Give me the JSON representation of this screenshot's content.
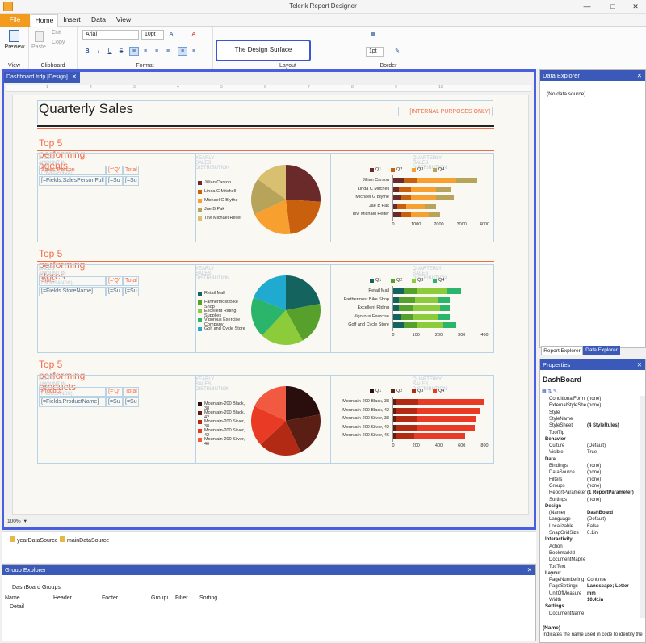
{
  "app": {
    "title": "Telerik Report Designer"
  },
  "tabs": [
    "File",
    "Home",
    "Insert",
    "Data",
    "View"
  ],
  "ribbon": {
    "preview_label": "Preview",
    "view_label": "View",
    "paste_label": "Paste",
    "cut_label": "Cut",
    "copy_label": "Copy",
    "clipboard_label": "Clipboard",
    "font_name": "Arial",
    "font_size": "10pt",
    "format_label": "Format",
    "callout": "The Design Surface",
    "layout_label": "Layout",
    "border_width": "1pt",
    "border_label": "Border"
  },
  "document": {
    "tab": "Dashboard.trdp [Design]",
    "ruler": [
      "1",
      "2",
      "3",
      "4",
      "5",
      "6",
      "7",
      "8",
      "9",
      "10"
    ],
    "title": "Quarterly Sales",
    "internal": "[INTERNAL PURPOSES ONLY]",
    "zoom": "100%"
  },
  "sections": [
    {
      "title": "Top 5 performing agents",
      "col1": "SALES AMOUNT IN USD (THOUSANDS)",
      "col2": "YEARLY SALES DISTRIBUTION",
      "col3": "QUARTERLY SALES DISTRIBUTION",
      "th": [
        "Sales Person",
        "[='Q'",
        "Total"
      ],
      "td": [
        "[=Fields.SalesPersonFull",
        "[=Su",
        "[=Su"
      ],
      "legend": [
        "Jillian  Carson",
        "Linda C Mitchell",
        "Michael G Blythe",
        "Jae B Pak",
        "Tsvi Michael Reiter"
      ],
      "colors": [
        "#6b2a2a",
        "#c8600e",
        "#f7a030",
        "#b7a45a",
        "#d8c070"
      ],
      "xticks": [
        "0",
        "1000",
        "2000",
        "3000",
        "4000"
      ],
      "quarters": [
        "Q1",
        "Q2",
        "Q3",
        "Q4"
      ]
    },
    {
      "title": "Top 5 performing stores",
      "col1": "SALES AMOUNT IN USD (THOUSANDS)",
      "col2": "YEARLY SALES DISTRIBUTION",
      "col3": "QUARTERLY SALES DISTRIBUTION",
      "th": [
        "Store",
        "[='Q'",
        "Total"
      ],
      "td": [
        "[=Fields.StoreName]",
        "[=Su",
        "[=Su"
      ],
      "legend": [
        "Retail Mall",
        "Farthermost Bike Shop",
        "Excellent Riding Supplies",
        "Vigorous Exercise Company",
        "Golf and Cycle Store"
      ],
      "colors": [
        "#14635f",
        "#58a02c",
        "#8ccc3a",
        "#2ab56a",
        "#20aad0"
      ],
      "xticks": [
        "0",
        "100",
        "200",
        "300",
        "400"
      ],
      "quarters": [
        "Q1",
        "Q2",
        "Q3",
        "Q4"
      ]
    },
    {
      "title": "Top 5 performing products",
      "col1": "SALES AMOUNT IN USD (THOUSANDS)",
      "col2": "YEARLY SALES DISTRIBUTION",
      "col3": "QUARTERLY SALES DISTRIBUTION",
      "th": [
        "Product",
        "[='Q'",
        "Total"
      ],
      "td": [
        "[=Fields.ProductName]",
        "[=Su",
        "[=Su"
      ],
      "legend": [
        "Mountain-200 Black, 38",
        "Mountain-200 Black, 42",
        "Mountain-200 Silver, 38",
        "Mountain-200 Silver, 42",
        "Mountain-200 Silver, 46"
      ],
      "legend_short": [
        "Mountain-200 Black, 38",
        "Mountain-200 Black, 42",
        "Mountain-200 Silver, 38",
        "Mountain-200 Silver, 42",
        "Mountain-200 Silver, 46"
      ],
      "colors": [
        "#2a0d0d",
        "#5a1e14",
        "#b22a14",
        "#e83a24",
        "#f15a40"
      ],
      "xticks": [
        "0",
        "200",
        "400",
        "600",
        "800"
      ],
      "quarters": [
        "Q1",
        "Q2",
        "Q3",
        "Q4"
      ]
    }
  ],
  "datasources": [
    "yearDataSource",
    "mainDataSource"
  ],
  "group_explorer": {
    "title": "Group Explorer",
    "groups_label": "DashBoard Groups",
    "cols": [
      "Name",
      "Header",
      "Footer",
      "Groupi...",
      "Filter",
      "Sorting"
    ],
    "row": "Detail"
  },
  "data_explorer": {
    "title": "Data Explorer",
    "item": "(No data source)"
  },
  "explorer_tabs": [
    "Report Explorer",
    "Data Explorer"
  ],
  "properties": {
    "title": "Properties",
    "object": "DashBoard",
    "rows": [
      [
        "ConditionalFormi",
        "(none)",
        ""
      ],
      [
        "ExternalStyleShe",
        "(none)",
        ""
      ],
      [
        "Style",
        "",
        ""
      ],
      [
        "StyleName",
        "",
        ""
      ],
      [
        "StyleSheet",
        "(4 StyleRules)",
        "b"
      ],
      [
        "ToolTip",
        "",
        ""
      ],
      [
        "Behavior",
        "",
        "c"
      ],
      [
        "Culture",
        "(Default)",
        ""
      ],
      [
        "Visible",
        "True",
        ""
      ],
      [
        "Data",
        "",
        "c"
      ],
      [
        "Bindings",
        "(none)",
        ""
      ],
      [
        "DataSource",
        "(none)",
        ""
      ],
      [
        "Filters",
        "(none)",
        ""
      ],
      [
        "Groups",
        "(none)",
        ""
      ],
      [
        "ReportParameter",
        "(1 ReportParameter)",
        "b"
      ],
      [
        "Sortings",
        "(none)",
        ""
      ],
      [
        "Design",
        "",
        "c"
      ],
      [
        "(Name)",
        "DashBoard",
        "b"
      ],
      [
        "Language",
        "(Default)",
        ""
      ],
      [
        "Localizable",
        "False",
        ""
      ],
      [
        "SnapGridSize",
        "0.1in",
        ""
      ],
      [
        "Interactivity",
        "",
        "c"
      ],
      [
        "Action",
        "",
        ""
      ],
      [
        "BookmarkId",
        "",
        ""
      ],
      [
        "DocumentMapTe",
        "",
        ""
      ],
      [
        "TocText",
        "",
        ""
      ],
      [
        "Layout",
        "",
        "c"
      ],
      [
        "PageNumbering",
        "Continue",
        ""
      ],
      [
        "PageSettings",
        "Landscape; Letter",
        "b"
      ],
      [
        "UnitOfMeasure",
        "mm",
        "b"
      ],
      [
        "Width",
        "10.41in",
        "b"
      ],
      [
        "Settings",
        "",
        "c"
      ],
      [
        "DocumentName",
        "",
        ""
      ]
    ],
    "desc_title": "(Name)",
    "desc": "Indicates the name used in code to identify the ..."
  },
  "chart_data": [
    {
      "type": "bar",
      "stacked": true,
      "orientation": "horizontal",
      "categories": [
        "Jillian  Carson",
        "Linda C Mitchell",
        "Michael G Blythe",
        "Jae B Pak",
        "Tsvi Michael Reiter"
      ],
      "series": [
        {
          "name": "Q1",
          "values": [
            500,
            300,
            400,
            200,
            400
          ]
        },
        {
          "name": "Q2",
          "values": [
            600,
            500,
            400,
            400,
            400
          ]
        },
        {
          "name": "Q3",
          "values": [
            1700,
            1100,
            1100,
            800,
            800
          ]
        },
        {
          "name": "Q4",
          "values": [
            900,
            700,
            800,
            500,
            500
          ]
        }
      ],
      "xlim": [
        0,
        4000
      ]
    },
    {
      "type": "bar",
      "stacked": true,
      "orientation": "horizontal",
      "categories": [
        "Retail Mall",
        "Farthermost Bike Shop",
        "Excellent Riding",
        "Vigorous Exercise",
        "Golf and Cycle Store"
      ],
      "series": [
        {
          "name": "Q1",
          "values": [
            50,
            30,
            30,
            40,
            50
          ]
        },
        {
          "name": "Q2",
          "values": [
            60,
            70,
            60,
            50,
            60
          ]
        },
        {
          "name": "Q3",
          "values": [
            130,
            100,
            120,
            110,
            110
          ]
        },
        {
          "name": "Q4",
          "values": [
            60,
            50,
            40,
            50,
            60
          ]
        }
      ],
      "xlim": [
        0,
        400
      ]
    },
    {
      "type": "bar",
      "stacked": true,
      "orientation": "horizontal",
      "categories": [
        "Mountain-200 Black, 38",
        "Mountain-200 Black, 42",
        "Mountain-200 Silver, 38",
        "Mountain-200 Silver, 42",
        "Mountain-200 Silver, 46"
      ],
      "series": [
        {
          "name": "Q1",
          "values": [
            10,
            10,
            10,
            10,
            10
          ]
        },
        {
          "name": "Q2",
          "values": [
            20,
            20,
            20,
            20,
            20
          ]
        },
        {
          "name": "Q3",
          "values": [
            200,
            190,
            180,
            180,
            160
          ]
        },
        {
          "name": "Q4",
          "values": [
            580,
            550,
            520,
            510,
            450
          ]
        }
      ],
      "xlim": [
        0,
        800
      ]
    },
    {
      "type": "pie",
      "labels": [
        "Jillian  Carson",
        "Linda C Mitchell",
        "Michael G Blythe",
        "Jae B Pak",
        "Tsvi Michael Reiter"
      ],
      "values": [
        26,
        22,
        20,
        17,
        15
      ]
    },
    {
      "type": "pie",
      "labels": [
        "Retail Mall",
        "Farthermost Bike Shop",
        "Excellent Riding Supplies",
        "Vigorous Exercise Company",
        "Golf and Cycle Store"
      ],
      "values": [
        22,
        20,
        20,
        19,
        19
      ]
    },
    {
      "type": "pie",
      "labels": [
        "Mountain-200 Black, 38",
        "Mountain-200 Black, 42",
        "Mountain-200 Silver, 38",
        "Mountain-200 Silver, 42",
        "Mountain-200 Silver, 46"
      ],
      "values": [
        22,
        21,
        20,
        19,
        18
      ]
    }
  ]
}
